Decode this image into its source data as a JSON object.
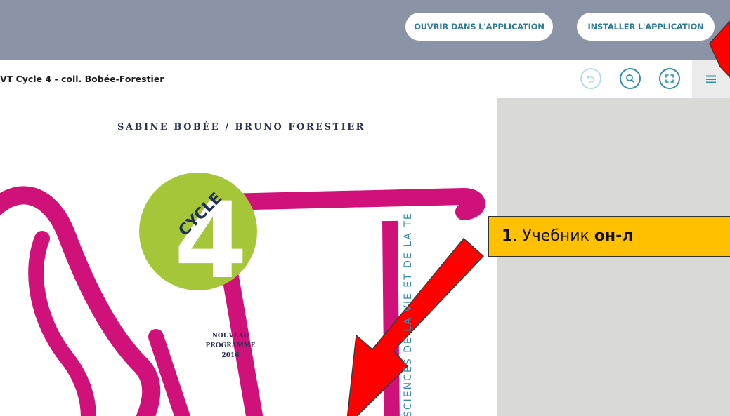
{
  "header": {
    "open_in_app_label": "OUVRIR DANS L'APPLICATION",
    "install_app_label": "INSTALLER L'APPLICATION"
  },
  "toolbar": {
    "document_title": "VT Cycle 4 - coll. Bobée-Forestier",
    "undo_icon": "undo-icon",
    "search_icon": "search-icon",
    "fullscreen_icon": "fullscreen-icon",
    "menu_icon": "hamburger-menu-icon"
  },
  "cover": {
    "authors": "SABINE BOBÉE / BRUNO FORESTIER",
    "cycle_word": "CYCLE",
    "cycle_number": "4",
    "program_lines": [
      "NOUVEAU",
      "PROGRAMME",
      "2016"
    ],
    "vertical_title": "SCIENCES DE LA VIE ET DE LA TERRE"
  },
  "annotation": {
    "number": "1",
    "text_regular": ". Учебник ",
    "text_bold": "он-л"
  },
  "colors": {
    "header_bg": "#8b93a6",
    "accent_teal": "#2f8fab",
    "magenta": "#d0117a",
    "lime": "#a5c638",
    "callout_bg": "#ffc000",
    "arrow_red": "#ff0000",
    "viewer_bg": "#d9d9d6"
  }
}
